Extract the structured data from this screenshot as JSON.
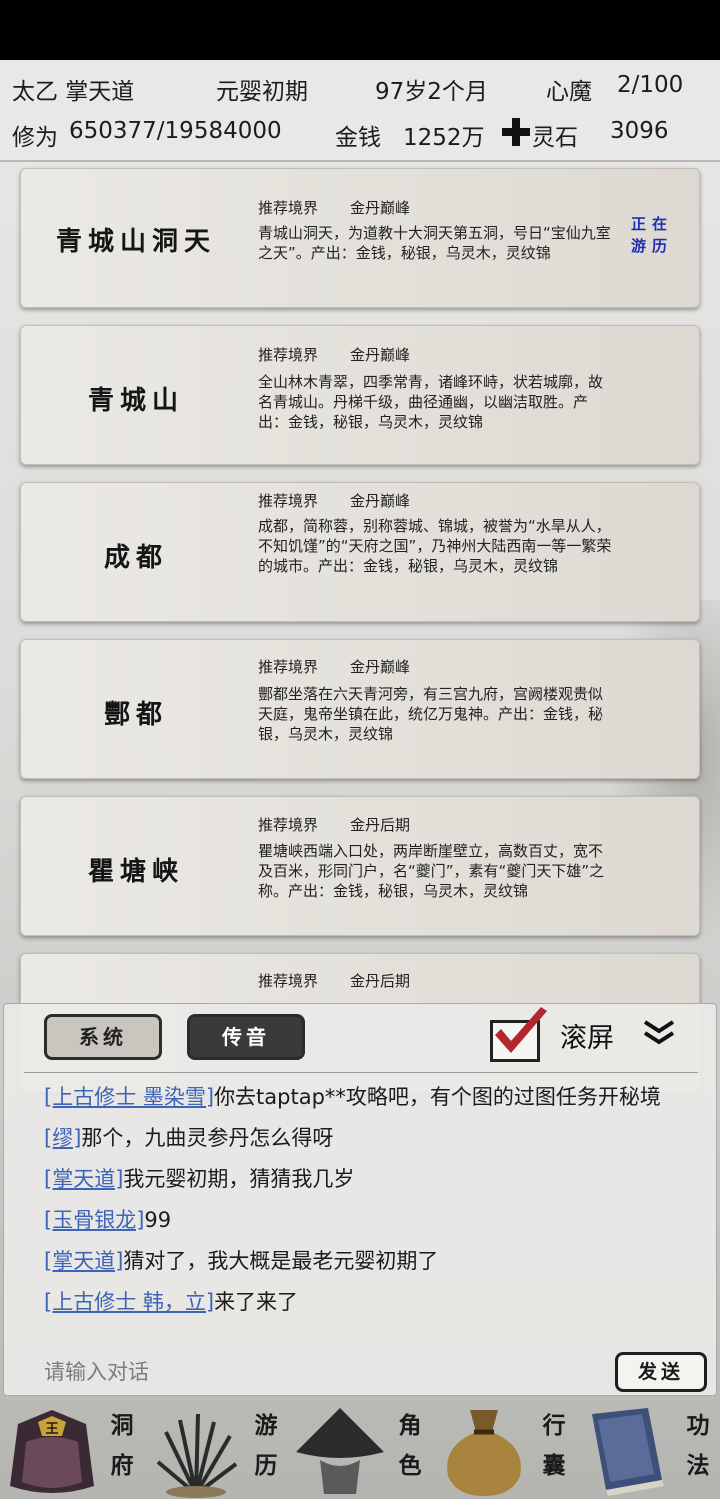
{
  "status": {
    "name": "太乙 掌天道",
    "realm": "元婴初期",
    "age": "97岁2个月",
    "inner_demon_label": "心魔",
    "inner_demon_value": "2/100",
    "cultivation_label": "修为",
    "cultivation_value": "650377/19584000",
    "money_label": "金钱",
    "money_value": "1252万",
    "spirit_stone_label": "灵石",
    "spirit_stone_value": "3096"
  },
  "locations": [
    {
      "name": "青城山洞天",
      "rec_label": "推荐境界",
      "rec_value": "金丹巅峰",
      "desc": "青城山洞天，为道教十大洞天第五洞，号日“宝仙九室之天”。产出：金钱，秘银，乌灵木，灵纹锦",
      "badge": "正在游历"
    },
    {
      "name": "青城山",
      "rec_label": "推荐境界",
      "rec_value": "金丹巅峰",
      "desc": "全山林木青翠，四季常青，诸峰环峙，状若城廓，故名青城山。丹梯千级，曲径通幽，以幽洁取胜。产出：金钱，秘银，乌灵木，灵纹锦"
    },
    {
      "name": "成都",
      "rec_label": "推荐境界",
      "rec_value": "金丹巅峰",
      "desc": "成都，简称蓉，别称蓉城、锦城，被誉为“水旱从人，不知饥馑”的“天府之国”，乃神州大陆西南一等一繁荣的城市。产出：金钱，秘银，乌灵木，灵纹锦"
    },
    {
      "name": "酆都",
      "rec_label": "推荐境界",
      "rec_value": "金丹巅峰",
      "desc": "酆都坐落在六天青河旁，有三宫九府，宫阙楼观贵似天庭，鬼帝坐镇在此，统亿万鬼神。产出：金钱，秘银，乌灵木，灵纹锦"
    },
    {
      "name": "瞿塘峡",
      "rec_label": "推荐境界",
      "rec_value": "金丹后期",
      "desc": "瞿塘峡西端入口处，两岸断崖壁立，高数百丈，宽不及百米，形同门户，名“夔门”，素有“夔门天下雄”之称。产出：金钱，秘银，乌灵木，灵纹锦"
    },
    {
      "name": "",
      "rec_label": "推荐境界",
      "rec_value": "金丹后期",
      "desc": ""
    }
  ],
  "chat": {
    "tab_system": "系统",
    "tab_message": "传音",
    "scroll_label": "滚屏",
    "messages": [
      {
        "sender": "[上古修士 墨染雪]",
        "text": "你去taptap**攻略吧，有个图的过图任务开秘境"
      },
      {
        "sender": "[缪]",
        "text": "那个，九曲灵参丹怎么得呀"
      },
      {
        "sender": "[掌天道]",
        "text": "我元婴初期，猜猜我几岁"
      },
      {
        "sender": "[玉骨银龙]",
        "text": "99"
      },
      {
        "sender": "[掌天道]",
        "text": "猜对了，我大概是最老元婴初期了"
      },
      {
        "sender": "[上古修士 韩，立]",
        "text": "来了来了"
      }
    ],
    "input_placeholder": "请输入对话",
    "send_label": "发送"
  },
  "nav": {
    "cave": "洞府",
    "travel": "游历",
    "character": "角色",
    "bag": "行囊",
    "skills": "功法",
    "cave_icon_text": "王"
  },
  "colors": {
    "sender_link": "#3e65b5",
    "traveling_badge": "#1b2fb0",
    "checkmark": "#b3262d"
  }
}
